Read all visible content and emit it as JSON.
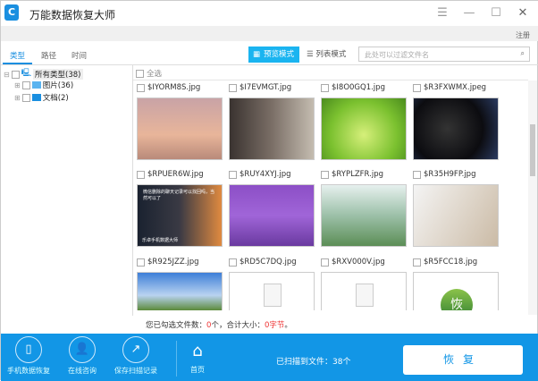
{
  "app": {
    "title": "万能数据恢复大师",
    "register": "注册",
    "logo": "C"
  },
  "tabs": [
    "类型",
    "路径",
    "时间"
  ],
  "view": {
    "preview_label": "预览模式",
    "list_label": "列表模式",
    "search_placeholder": "此处可以过滤文件名"
  },
  "tree": [
    {
      "label": "所有类型(38)"
    },
    {
      "label": "图片(36)"
    },
    {
      "label": "文档(2)"
    }
  ],
  "select_all": "全选",
  "files": [
    {
      "name": "$IYORM8S.jpg"
    },
    {
      "name": "$I7EVMGT.jpg"
    },
    {
      "name": "$I8O0GQ1.jpg"
    },
    {
      "name": "$R3FXWMX.jpeg"
    },
    {
      "name": "$RPUER6W.jpg"
    },
    {
      "name": "$RUY4XYJ.jpg"
    },
    {
      "name": "$RYPLZFR.jpg"
    },
    {
      "name": "$R35H9FP.jpg"
    },
    {
      "name": "$R925JZZ.jpg"
    },
    {
      "name": "$RD5C7DQ.jpg"
    },
    {
      "name": "$RXV000V.jpg"
    },
    {
      "name": "$R5FCC18.jpg"
    }
  ],
  "thumb_overlay": {
    "caption1": "微信删除的聊天记录可以找回吗，当然可以了",
    "caption2": "乐卓手机数据大师",
    "last_thumb": "恢"
  },
  "status": {
    "prefix": "您已勾选文件数：",
    "count": "0",
    "mid": "个，合计大小：",
    "size": "0字节",
    "suffix": "。"
  },
  "footer": {
    "phone": "手机数据恢复",
    "consult": "在线咨询",
    "save": "保存扫描记录",
    "home": "首页",
    "scanned": "已扫描到文件：38个",
    "recover": "恢复"
  },
  "colors": {
    "accent": "#1296e6",
    "preview_btn": "#1ab4f0",
    "highlight": "#ee3333"
  }
}
